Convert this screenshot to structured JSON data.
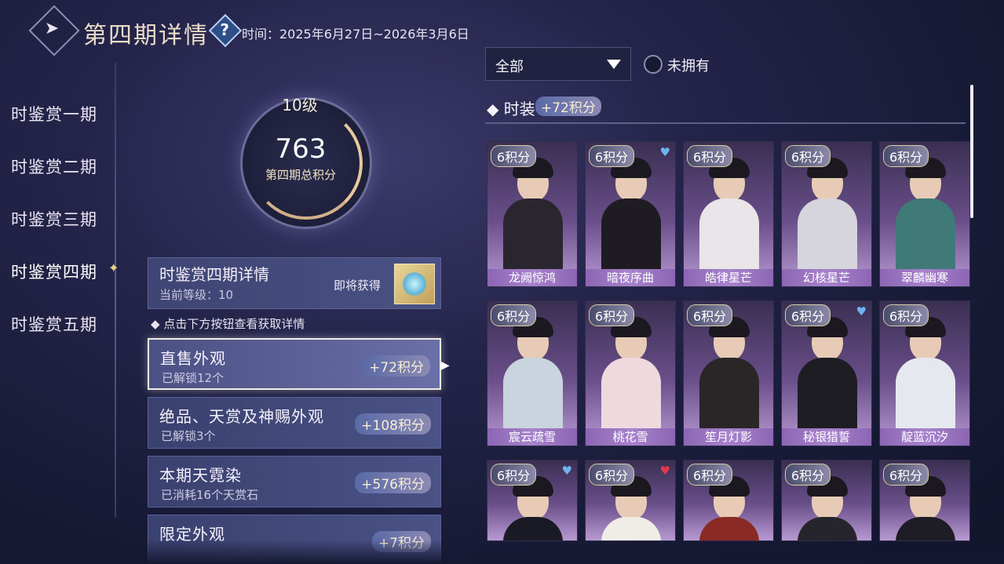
{
  "header": {
    "title": "第四期详情",
    "help_icon": "?",
    "time": "时间：2025年6月27日~2026年3月6日"
  },
  "nav": {
    "items": [
      {
        "label": "时鉴赏一期"
      },
      {
        "label": "时鉴赏二期"
      },
      {
        "label": "时鉴赏三期"
      },
      {
        "label": "时鉴赏四期",
        "active": true
      },
      {
        "label": "时鉴赏五期"
      }
    ]
  },
  "score": {
    "level": "10级",
    "points": "763",
    "label": "第四期总积分"
  },
  "detail": {
    "title": "时鉴赏四期详情",
    "level": "当前等级：10",
    "soon": "即将获得"
  },
  "hint": "点击下方按钮查看获取详情",
  "categories": [
    {
      "name": "直售外观",
      "sub": "已解锁12个",
      "points": "+72积分",
      "active": true
    },
    {
      "name": "绝品、天赏及神赐外观",
      "sub": "已解锁3个",
      "points": "+108积分"
    },
    {
      "name": "本期天霓染",
      "sub": "已消耗16个天赏石",
      "points": "+576积分"
    },
    {
      "name": "限定外观",
      "sub": "",
      "points": "+7积分"
    }
  ],
  "filter": {
    "dropdown": "全部",
    "unowned_label": "未拥有"
  },
  "section": {
    "title": "时装",
    "points": "+72积分"
  },
  "colors": {
    "accent_gold": "#e6c99a",
    "name_bar": "#a782cc",
    "heart_blue": "#6fb4ee",
    "heart_red": "#e0384e"
  },
  "outfits": [
    {
      "badge": "6积分",
      "name": "龙阙惊鸿",
      "heart": "",
      "outfit": "#2a2630"
    },
    {
      "badge": "6积分",
      "name": "暗夜序曲",
      "heart": "blue",
      "outfit": "#1e1c22"
    },
    {
      "badge": "6积分",
      "name": "皓律星芒",
      "heart": "",
      "outfit": "#e9e5e8"
    },
    {
      "badge": "6积分",
      "name": "幻核星芒",
      "heart": "",
      "outfit": "#d6d4dc"
    },
    {
      "badge": "6积分",
      "name": "翠麟幽寒",
      "heart": "",
      "outfit": "#3f7a78"
    },
    {
      "badge": "6积分",
      "name": "宸云疏雪",
      "heart": "",
      "outfit": "#c9d4de"
    },
    {
      "badge": "6积分",
      "name": "桃花雪",
      "heart": "",
      "outfit": "#efd8de"
    },
    {
      "badge": "6积分",
      "name": "笙月灯影",
      "heart": "",
      "outfit": "#2a2628"
    },
    {
      "badge": "6积分",
      "name": "秘银猎誓",
      "heart": "blue",
      "outfit": "#1f1d24"
    },
    {
      "badge": "6积分",
      "name": "靛蓝沉汐",
      "heart": "",
      "outfit": "#e6e8f0"
    },
    {
      "badge": "6积分",
      "name": "",
      "heart": "blue",
      "outfit": "#1a1a24"
    },
    {
      "badge": "6积分",
      "name": "",
      "heart": "red",
      "outfit": "#f0ece6"
    },
    {
      "badge": "6积分",
      "name": "",
      "heart": "",
      "outfit": "#8a2a24"
    },
    {
      "badge": "6积分",
      "name": "",
      "heart": "",
      "outfit": "#26242c"
    },
    {
      "badge": "6积分",
      "name": "",
      "heart": "",
      "outfit": "#1e1c24"
    }
  ]
}
